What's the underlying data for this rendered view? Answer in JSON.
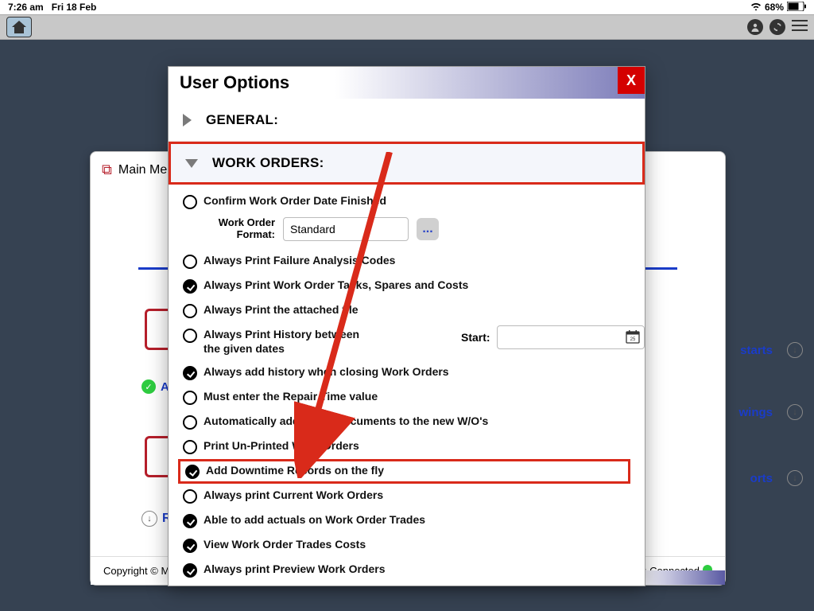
{
  "status_bar": {
    "time": "7:26 am",
    "date": "Fri 18 Feb",
    "battery": "68%"
  },
  "bg": {
    "menu_title": "Main Mer",
    "links": {
      "starts": "starts",
      "wings": "wings",
      "orts": "orts"
    },
    "refresh": "Re",
    "approved_prefix": "A",
    "footer_left": "Copyright © Ma",
    "footer_right": ": Connected"
  },
  "modal": {
    "title": "User Options",
    "close": "X",
    "sections": {
      "general": "GENERAL:",
      "work_orders": "WORK ORDERS:"
    },
    "wof": {
      "label": "Work Order Format:",
      "value": "Standard",
      "more": "..."
    },
    "start_label": "Start:",
    "options": [
      {
        "label": "Confirm Work Order Date Finished",
        "on": false
      },
      {
        "label": "Always Print Failure Analysis Codes",
        "on": false
      },
      {
        "label": "Always Print Work Order Tasks, Spares and Costs",
        "on": true
      },
      {
        "label": "Always Print the attached file",
        "on": false
      },
      {
        "label": "Always Print History between the given dates",
        "on": false,
        "wrap": true
      },
      {
        "label": "Always add history when closing Work Orders",
        "on": true
      },
      {
        "label": "Must enter the Repair Time value",
        "on": false
      },
      {
        "label": "Automatically add Asset Documents to the new W/O's",
        "on": false
      },
      {
        "label": "Print Un-Printed Work Orders",
        "on": false
      },
      {
        "label": "Add Downtime Records on the fly",
        "on": true,
        "highlight": true
      },
      {
        "label": "Always print Current Work Orders",
        "on": false
      },
      {
        "label": "Able to add actuals on Work Order Trades",
        "on": true
      },
      {
        "label": "View Work Order Trades Costs",
        "on": true
      },
      {
        "label": "Always print Preview Work Orders",
        "on": true
      }
    ]
  }
}
